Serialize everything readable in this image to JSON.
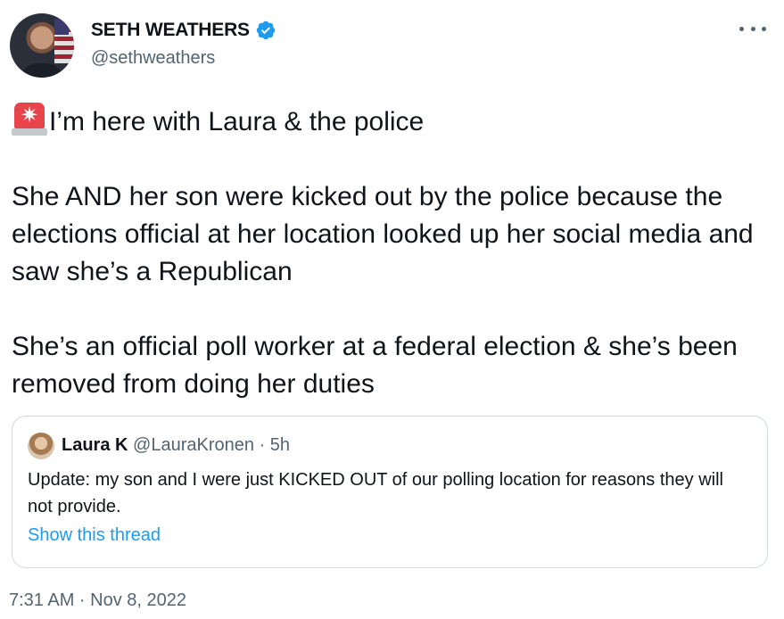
{
  "author": {
    "display_name": "SETH WEATHERS",
    "handle": "@sethweathers",
    "verified_icon": "verified-badge-icon",
    "verified_color": "#1d9bf0"
  },
  "tweet": {
    "siren_icon": "police-siren-icon",
    "paragraphs": [
      "I’m here with Laura & the police",
      "She AND her son were kicked out by the police because the elections official at her location looked up her social media and saw she’s a Republican",
      "She’s an official poll worker at a federal election & she’s been removed from doing her duties"
    ]
  },
  "quote": {
    "name": "Laura K",
    "handle": "@LauraKronen",
    "separator": " · ",
    "time": "5h",
    "text": "Update:  my son and I were just KICKED OUT of our polling location for reasons they will not provide.",
    "link": "Show this thread"
  },
  "footer": {
    "timestamp": "7:31 AM · Nov 8, 2022"
  },
  "colors": {
    "text": "#0f1419",
    "secondary": "#536471",
    "link": "#1d9bf0",
    "border": "#cfd9de",
    "siren": "#e8444c"
  }
}
